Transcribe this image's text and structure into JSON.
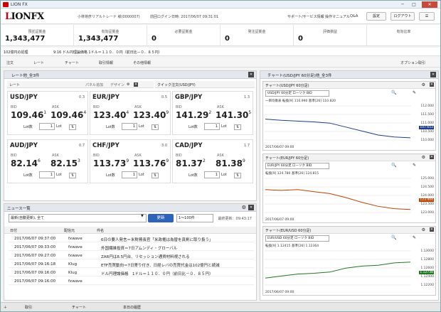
{
  "window": {
    "title": "LION FX"
  },
  "header": {
    "user": "小林将彦リアルトレード 様(0000007)",
    "last_login": "前回ログイン日時: 2017/06/07 09:31:01",
    "links": [
      "サポート/サービス情報",
      "操作マニュアル",
      "Q&A"
    ],
    "settings": "設定",
    "logout": "ログアウト"
  },
  "summary": [
    {
      "label": "預託証拠金",
      "value": "1,343,477"
    },
    {
      "label": "有効証拠金",
      "value": "1,343,477"
    },
    {
      "label": "必要証拠金",
      "value": "0"
    },
    {
      "label": "発注証拠金",
      "value": "0"
    },
    {
      "label": "評価損益",
      "value": "0"
    },
    {
      "label": "有効比率",
      "value": ""
    }
  ],
  "ticker": {
    "a": "102億円の処理",
    "b": "9:16  ドル円理論価格  1ドル＝１１０．０円（前日比－０．８５円）"
  },
  "menu": [
    "注文",
    "レート",
    "チャート",
    "取引情報",
    "その他情報"
  ],
  "menu_right": "オプション取引",
  "rates_panel": {
    "title": "レート他_全3件",
    "tab": "レート",
    "tab_links": [
      "パネル追加",
      "デザイン"
    ],
    "quick": "クイック注文(USD/JPY)"
  },
  "rates": [
    {
      "pair": "USD/JPY",
      "spread": "0.3",
      "bid_main": "109.46",
      "bid_sup": "1",
      "ask_main": "109.46",
      "ask_sup": "4"
    },
    {
      "pair": "EUR/JPY",
      "spread": "0.5",
      "bid_main": "123.40",
      "bid_sup": "4",
      "ask_main": "123.40",
      "ask_sup": "9"
    },
    {
      "pair": "GBP/JPY",
      "spread": "1.3",
      "bid_main": "141.29",
      "bid_sup": "2",
      "ask_main": "141.30",
      "ask_sup": "5"
    },
    {
      "pair": "AUD/JPY",
      "spread": "0.7",
      "bid_main": "82.14",
      "bid_sup": "6",
      "ask_main": "82.15",
      "ask_sup": "3"
    },
    {
      "pair": "CHF/JPY",
      "spread": "3.0",
      "bid_main": "113.73",
      "bid_sup": "9",
      "ask_main": "113.76",
      "ask_sup": "9"
    },
    {
      "pair": "CAD/JPY",
      "spread": "1.7",
      "bid_main": "81.37",
      "bid_sup": "2",
      "ask_main": "81.38",
      "ask_sup": "9"
    }
  ],
  "rate_labels": {
    "bid": "BID",
    "ask": "ASK",
    "lot_label": "Lot数",
    "lot_value": "1",
    "lot_unit": "Lot"
  },
  "news": {
    "title": "ニュース一覧",
    "filter": "最新(自動更新), 全て",
    "update_btn": "更新",
    "range": "1〜100件",
    "last_updated": "最終更新：09:43:17",
    "col_date": "日付",
    "col_source": "配信元",
    "col_title": "件名",
    "rows": [
      {
        "date": "2017/06/07 09:37:00",
        "src": "fxwave",
        "title": "6日の要人発言＝米財務長官「米政権は為替を真剣に取り扱う」"
      },
      {
        "date": "2017/06/07 09:33:00",
        "src": "fxwave",
        "title": "外国繊維投資＝7日アムンディ・グローバル"
      },
      {
        "date": "2017/06/07 09:27:00",
        "src": "fxwave",
        "title": "ZAR円は8.5円台、リセッション通貨材料視される"
      },
      {
        "date": "2017/06/07 09:16:18",
        "src": "Klug",
        "title": "ETF売買動向＝7日寄り付き、日経レバの売買代金は102億円と続減"
      },
      {
        "date": "2017/06/07 09:16:00",
        "src": "Klug",
        "title": "ドル円理論価格　1ドル＝１１０．０円（前日比－０．８５円）"
      },
      {
        "date": "2017/06/07 09:16:00",
        "src": "fxwave",
        "title": ""
      }
    ]
  },
  "charts_panel": {
    "title": "チャート(USD/JPY 60分足)他_全3件"
  },
  "charts": [
    {
      "title": "チャート(USD/JPY 60分足)",
      "pair": "USD/JPY 60分足 ローソク BID",
      "legend": "一目均衡表 転換[9] 110.990  基準[26] 110.820",
      "price_tag": "107.653",
      "axis": [
        "112.000",
        "111.500",
        "111.000",
        "110.500",
        "110.000"
      ],
      "date": "2017/06/07 09:00",
      "color": "#1f3c8a",
      "trend": [
        0.35,
        0.38,
        0.4,
        0.42,
        0.45,
        0.55,
        0.65,
        0.75,
        0.8,
        0.82
      ]
    },
    {
      "title": "チャート(EUR/JPY 60分足)",
      "pair": "EUR/JPY 60分足 ローソク BID",
      "legend": "転換[9] 124.780  基準[26] 124.815",
      "price_tag": "123.404",
      "axis": [
        "125.000",
        "124.500",
        "124.000",
        "123.500",
        "123.000"
      ],
      "date": "2017/06/07 09:00",
      "color": "#c04000",
      "trend": [
        0.3,
        0.32,
        0.3,
        0.35,
        0.4,
        0.5,
        0.62,
        0.72,
        0.78,
        0.8
      ]
    },
    {
      "title": "チャート(EUR/USD 60分足)",
      "pair": "EUR/USD 60分足 ローソク BID",
      "legend": "転換[9] 1.12415  基準[26] 1.12364",
      "price_tag": "1.12738",
      "axis": [
        "1.13000",
        "1.12800",
        "1.12600",
        "1.12400",
        "1.12200"
      ],
      "date": "2017/06/07 09:00",
      "color": "#1f7a1f",
      "trend": [
        0.7,
        0.65,
        0.6,
        0.58,
        0.55,
        0.45,
        0.4,
        0.38,
        0.32,
        0.3
      ]
    }
  ],
  "footer_tabs": [
    "取引",
    "チャート",
    "本日の履歴"
  ]
}
